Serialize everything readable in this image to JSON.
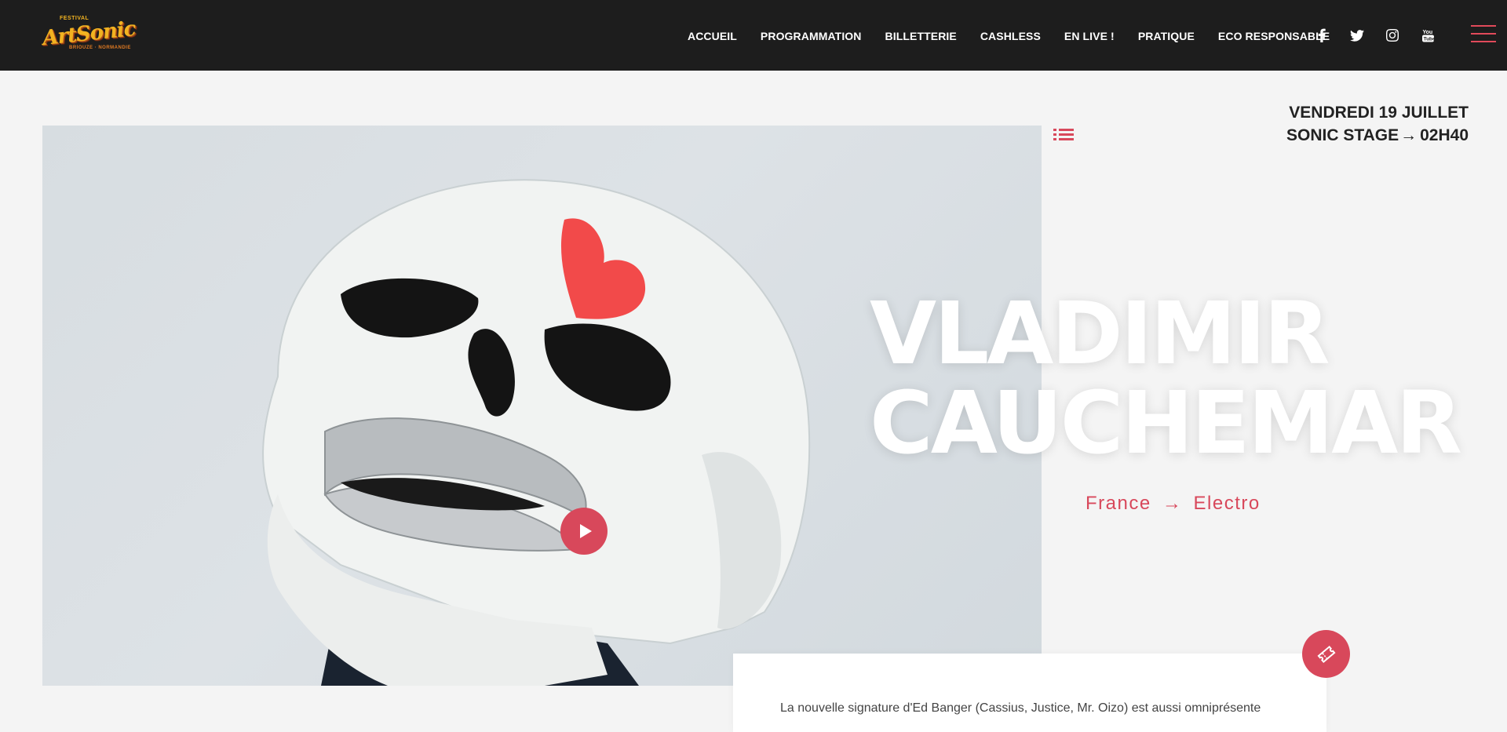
{
  "brand": {
    "name": "ArtSonic",
    "tagline_top": "FESTIVAL",
    "tagline_bottom": "BRIOUZE · NORMANDIE"
  },
  "nav": {
    "items": [
      {
        "label": "ACCUEIL"
      },
      {
        "label": "PROGRAMMATION"
      },
      {
        "label": "BILLETTERIE"
      },
      {
        "label": "CASHLESS"
      },
      {
        "label": "EN LIVE !"
      },
      {
        "label": "PRATIQUE"
      },
      {
        "label": "ECO RESPONSABLE"
      }
    ],
    "social": [
      "facebook-icon",
      "twitter-icon",
      "instagram-icon",
      "youtube-icon"
    ],
    "menu_icon": "hamburger-menu-icon"
  },
  "event": {
    "date": "VENDREDI 19 JUILLET",
    "stage": "SONIC STAGE",
    "arrow": "→",
    "time": "02H40"
  },
  "artist": {
    "name_line1": "VLADIMIR",
    "name_line2": "CAUCHEMAR",
    "country": "France",
    "arrow": "→",
    "genre": "Electro",
    "description": "La nouvelle signature d'Ed Banger (Cassius, Justice, Mr. Oizo) est aussi omniprésente"
  },
  "icons": {
    "play": "play-icon",
    "list": "list-icon",
    "ticket": "ticket-icon"
  },
  "colors": {
    "accent": "#d8485b",
    "header_bg": "#1d1d1d",
    "page_bg": "#f4f4f4",
    "logo_gold": "#f2b321"
  }
}
